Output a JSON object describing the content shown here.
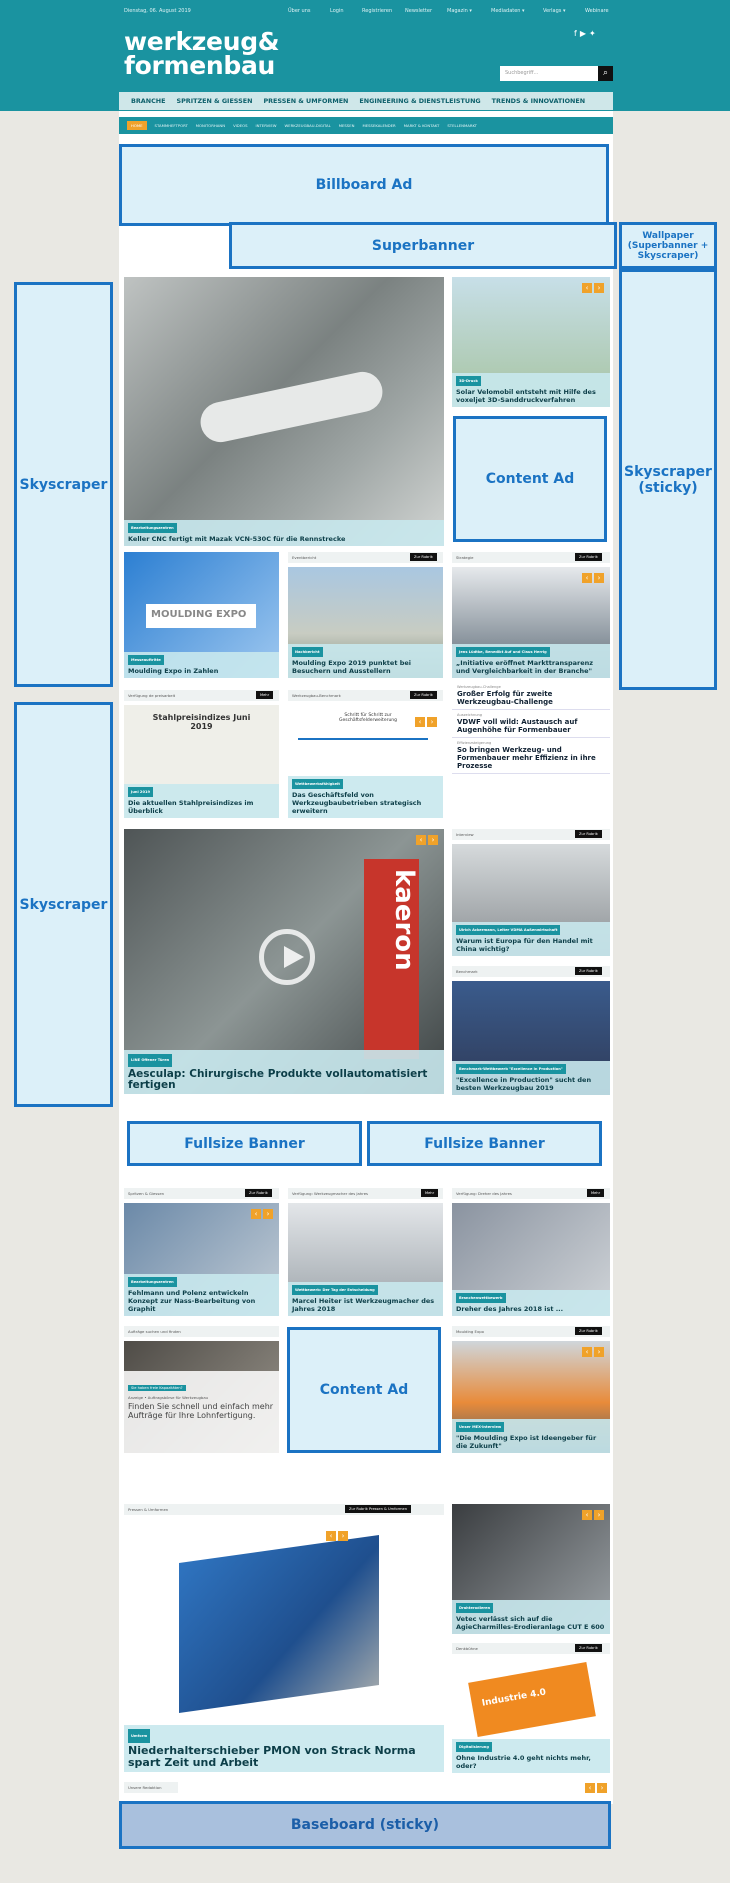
{
  "topbar": {
    "date": "Dienstag, 06. August 2019",
    "links": [
      "Über uns",
      "Login",
      "Registrieren",
      "Newsletter",
      "Magazin ▾",
      "Mediadaten ▾",
      "Verlags ▾",
      "Webinare"
    ]
  },
  "logo": {
    "line1": "werkzeug&",
    "line2": "formenbau"
  },
  "search": {
    "placeholder": "Suchbegriff..."
  },
  "main_nav": [
    "BRANCHE",
    "SPRITZEN & GIESSEN",
    "PRESSEN & UMFORMEN",
    "ENGINEERING & DIENSTLEISTUNG",
    "TRENDS & INNOVATIONEN"
  ],
  "sub_nav": {
    "active": "HOME",
    "items": [
      "STAMMHEFTPORT",
      "MONITORHANN",
      "VIDEOS",
      "INTERVIEW",
      "WERKZEUGBAU-DIGITAL",
      "MESSEN",
      "MESSEKALENDER",
      "MARKT & KONTAKT",
      "STELLENMARKT"
    ]
  },
  "ads": {
    "billboard": "Billboard Ad",
    "superbanner": "Superbanner",
    "wallpaper": "Wallpaper (Superbanner + Skyscraper)",
    "skyscraper_left_1": "Skyscraper",
    "skyscraper_left_2": "Skyscraper",
    "skyscraper_sticky": "Skyscraper (sticky)",
    "content_ad_1": "Content Ad",
    "content_ad_2": "Content Ad",
    "fullsize_1": "Fullsize Banner",
    "fullsize_2": "Fullsize Banner",
    "baseboard": "Baseboard (sticky)"
  },
  "hero": {
    "tag": "Bearbeitungszentren",
    "title": "Keller CNC fertigt mit Mazak VCN-530C für die Rennstrecke"
  },
  "solar": {
    "tag": "3D-Druck",
    "title": "Solar Velomobil entsteht mit Hilfe des voxeljet 3D-Sanddruckverfahren"
  },
  "row2": [
    {
      "section": "",
      "tag": "Messeauftritte",
      "title": "Moulding Expo in Zahlen",
      "expo": "MOULDING EXPO"
    },
    {
      "section": "Eventbericht",
      "btn": "Zur Rubrik",
      "tag": "Nachbericht",
      "title": "Moulding Expo 2019 punktet bei Besuchern und Ausstellern"
    },
    {
      "section": "Strategie",
      "btn": "Zur Rubrik",
      "tag": "Jens Lüdtke, Benedikt Auf und Claus Herrig",
      "title": "„Initiative eröffnet Markttransparenz und Vergleichbarkeit in der Branche\""
    }
  ],
  "row3": [
    {
      "section": "Verfügung de preisarbeit",
      "btn": "Mehr",
      "sheet_title": "Stahlpreisindizes Juni 2019",
      "tag": "Juni 2019",
      "title": "Die aktuellen Stahlpreisindizes im Überblick"
    },
    {
      "section": "Werkzeugbau-Benchmark",
      "btn": "Zur Rubrik",
      "diagram_title": "Schritt für Schritt zur Geschäftsfelderweiterung",
      "tag": "Wettbewerbsfähigkeit",
      "title": "Das Geschäftsfeld von Werkzeugbaubetrieben strategisch erweitern"
    }
  ],
  "list_items": [
    {
      "kicker": "Werkzeugbau-Challenge",
      "title": "Großer Erfolg für zweite Werkzeugbau-Challenge"
    },
    {
      "kicker": "Auszeichnung",
      "title": "VDWF voll wild: Austausch auf Augenhöhe für Formenbauer"
    },
    {
      "kicker": "Effizienzsteigerung",
      "title": "So bringen Werkzeug- und Formenbauer mehr Effizienz in ihre Prozesse"
    }
  ],
  "video": {
    "tag": "LINE Offener Türen",
    "title": "Aesculap: Chirurgische Produkte vollautomatisiert fertigen",
    "brand": "kaeron"
  },
  "interview": {
    "section": "Interview",
    "btn": "Zur Rubrik",
    "tag": "Ulrich Ackermann, Leiter VDMA Außenwirtschaft",
    "title": "Warum ist Europa für den Handel mit China wichtig?"
  },
  "excellence": {
    "section": "Benchmark",
    "btn": "Zur Rubrik",
    "tag": "Benchmark-Wettbewerb \"Excellence in Production\"",
    "title": "\"Excellence in Production\" sucht den besten Werkzeugbau 2019"
  },
  "row5": [
    {
      "section": "Spritzen & Giessen",
      "btn": "Zur Rubrik",
      "tag": "Bearbeitungszentren",
      "title": "Fehlmann und Polenz entwickeln Konzept zur Nass-Bearbeitung von Graphit"
    },
    {
      "section": "Verfügung: Werkzeugmacher des Jahres",
      "btn": "Mehr",
      "tag": "Wettbewerb: Der Tag der Entscheidung",
      "title": "Marcel Heiter ist Werkzeugmacher des Jahres 2018"
    },
    {
      "section": "Verfügung: Dreher des Jahres",
      "btn": "Mehr",
      "tag": "Branchenwettbewerb",
      "title": "Dreher des Jahres 2018 ist ..."
    }
  ],
  "auftraege": {
    "section": "Aufträge suchen und finden",
    "tag": "Sie haben freie Kapazitäten?",
    "meta": "Anzeige • Auftragsbörse für Werkzeugbau",
    "title": "Finden Sie schnell und einfach mehr Aufträge für Ihre Lohnfertigung."
  },
  "mexpo": {
    "section": "Moulding Expo",
    "btn": "Zur Rubrik",
    "tag": "Unser MEX-Interview",
    "title": "\"Die Moulding Expo ist Ideengeber für die Zukunft\""
  },
  "pressen": {
    "section": "Pressen & Umformen",
    "btn": "Zur Rubrik Pressen & Umformen",
    "tag": "Umform",
    "title": "Niederhalterschieber PMON von Strack Norma spart Zeit und Arbeit"
  },
  "vetec": {
    "tag": "Drahterodieren",
    "title": "Vetec verlässt sich auf die AgieCharmilles-Erodieranlage CUT E 600"
  },
  "industrie": {
    "section": "Denkbühne",
    "btn": "Zur Rubrik",
    "puzzle": "Industrie 4.0",
    "tag": "Digitalisierung",
    "title": "Ohne Industrie 4.0 geht nichts mehr, oder?"
  },
  "footer_section": "Unsere Redaktion",
  "colors": {
    "teal": "#1a93a0",
    "ad_blue": "#1b73c3",
    "ad_fill": "#dcf0f9",
    "orange": "#f0a22a",
    "baseboard": "#a9c0dd"
  }
}
